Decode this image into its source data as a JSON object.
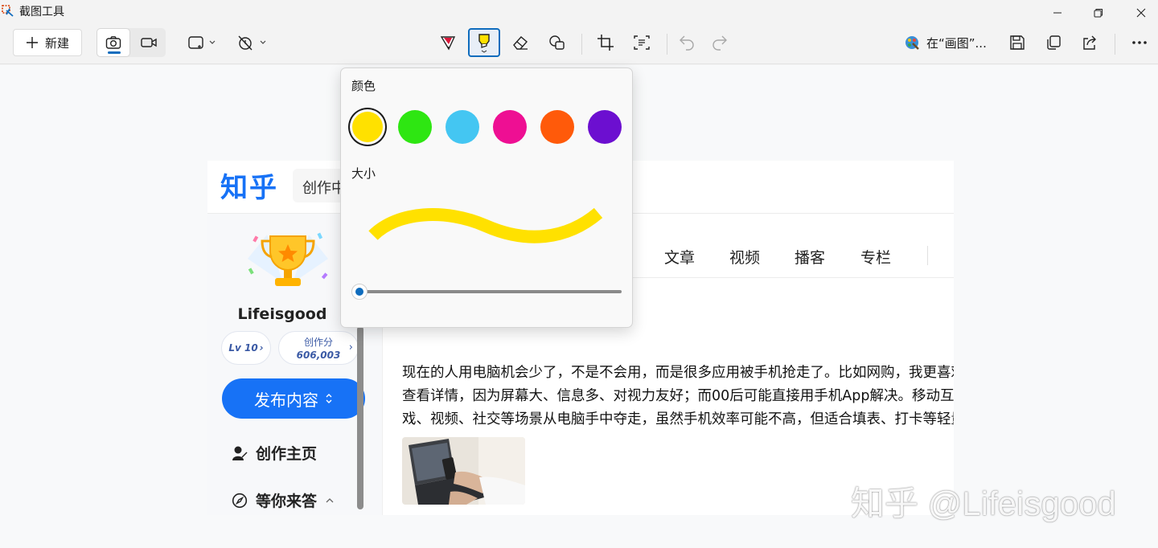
{
  "window": {
    "title": "截图工具"
  },
  "toolbar": {
    "new_label": "新建",
    "open_in_paint_label": "在“画图”...",
    "icons": [
      "plus-icon",
      "camera-icon",
      "video-icon",
      "rectangle-mode-icon",
      "timer-off-icon",
      "ballpoint-pen-icon",
      "highlighter-icon",
      "eraser-icon",
      "shapes-icon",
      "crop-icon",
      "text-actions-icon",
      "undo-icon",
      "redo-icon",
      "paint-app-icon",
      "save-icon",
      "copy-icon",
      "share-icon",
      "more-icon"
    ]
  },
  "highlighter_popup": {
    "color_label": "颜色",
    "size_label": "大小",
    "colors": [
      "#ffe100",
      "#2ee612",
      "#44c6f2",
      "#ee0f93",
      "#ff5a0a",
      "#6c0fd0"
    ],
    "selected_color": "#ffe100",
    "size_fraction": 0.0
  },
  "screenshot": {
    "logo": "知乎",
    "search_text": "创作中",
    "username": "Lifeisgood",
    "level": "Lv 10",
    "score_label": "创作分",
    "score_value": "606,003",
    "publish_label": "发布内容",
    "sidebar_items": [
      "创作主页",
      "等你来答"
    ],
    "tabs": [
      "文章",
      "视频",
      "播客",
      "专栏"
    ],
    "article_lines": [
      "现在的人用电脑机会少了，不是不会用，而是很多应用被手机抢走了。比如网购，我更喜欢在",
      "查看详情，因为屏幕大、信息多、对视力友好；而00后可能直接用手机App解决。移动互联",
      "戏、视频、社交等场景从电脑手中夺走，虽然手机效率可能不高，但适合填表、打卡等轻量场"
    ]
  },
  "watermark": "知乎 @Lifeisgood"
}
